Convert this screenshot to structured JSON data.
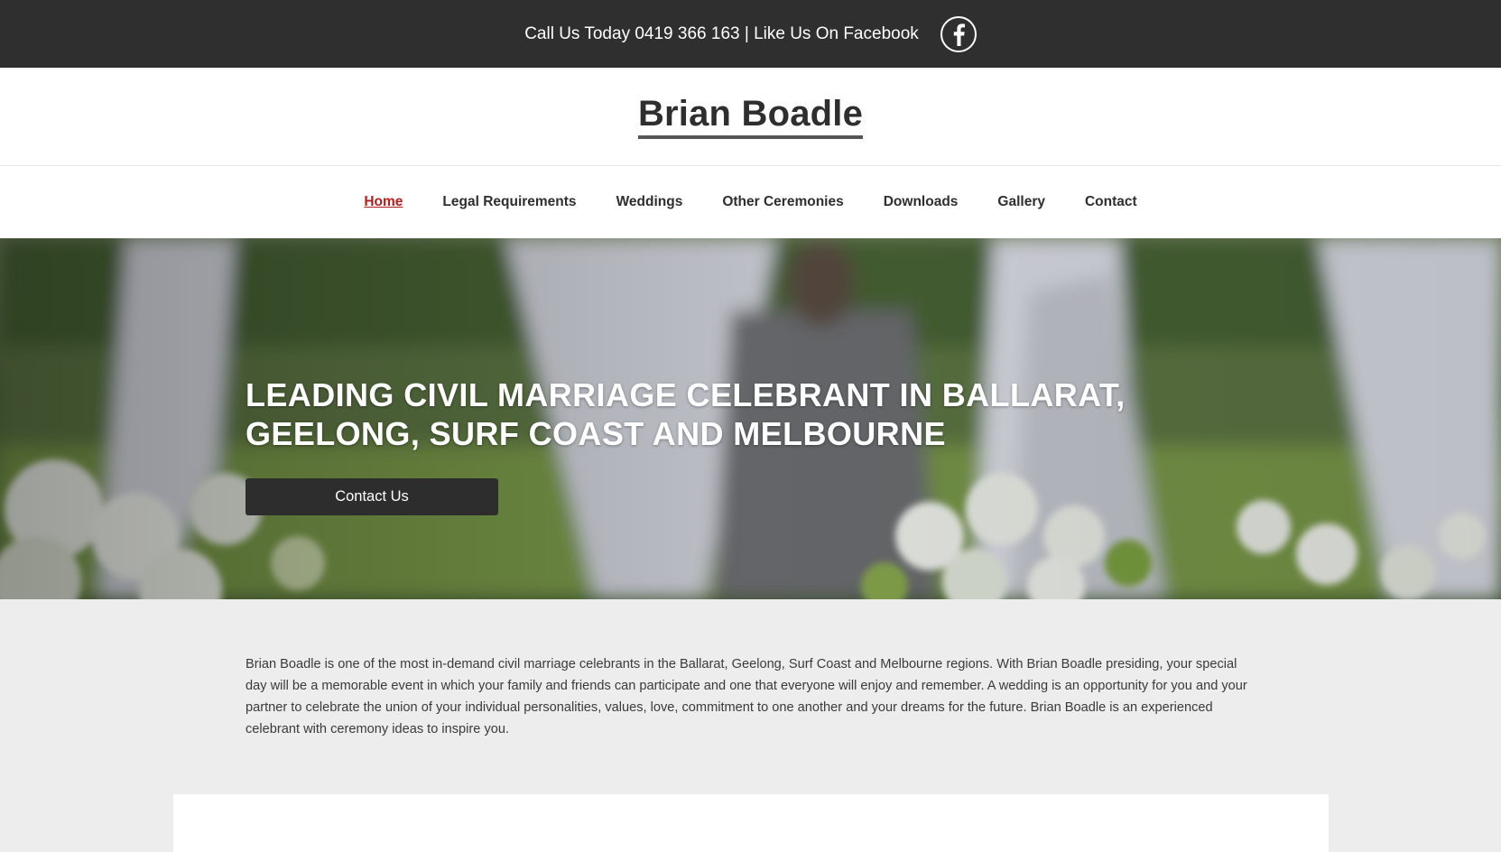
{
  "topbar": {
    "contact_text": "Call Us Today 0419 366 163 | Like Us On Facebook",
    "facebook_icon": "facebook-icon"
  },
  "header": {
    "logo": "Brian Boadle"
  },
  "nav": {
    "items": [
      {
        "label": "Home",
        "active": true
      },
      {
        "label": "Legal Requirements",
        "active": false
      },
      {
        "label": "Weddings",
        "active": false
      },
      {
        "label": "Other Ceremonies",
        "active": false
      },
      {
        "label": "Downloads",
        "active": false
      },
      {
        "label": "Gallery",
        "active": false
      },
      {
        "label": "Contact",
        "active": false
      }
    ]
  },
  "hero": {
    "title": "LEADING CIVIL MARRIAGE CELEBRANT IN BALLARAT, GEELONG, SURF COAST AND MELBOURNE",
    "button_label": "Contact Us"
  },
  "intro": {
    "text": "Brian Boadle is one of the most in-demand civil marriage celebrants in the Ballarat, Geelong, Surf Coast and Melbourne regions. With Brian Boadle presiding, your special day will be a memorable event in which your family and friends can participate and one that everyone will enjoy and remember. A wedding is an opportunity for you and your partner to celebrate the union of your individual personalities, values, love, commitment to one another and your dreams for the future. Brian Boadle is an experienced celebrant with ceremony ideas to inspire you."
  },
  "colors": {
    "topbar_bg": "#2f2f2f",
    "nav_active": "#b21e1e",
    "button_bg": "#2d2d2d",
    "page_bg": "#ededed"
  }
}
